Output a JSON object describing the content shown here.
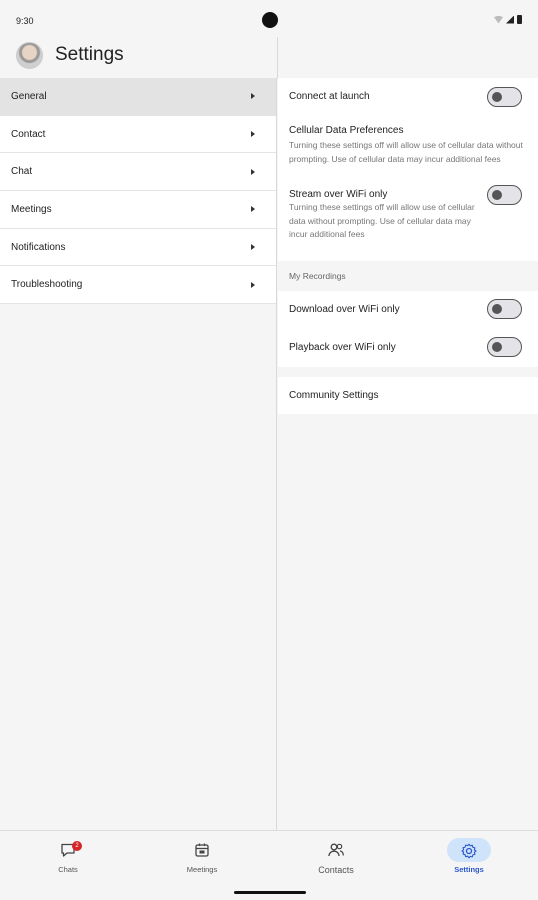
{
  "status": {
    "time": "9:30"
  },
  "header": {
    "title": "Settings"
  },
  "menu": [
    {
      "label": "General",
      "active": true
    },
    {
      "label": "Contact"
    },
    {
      "label": "Chat"
    },
    {
      "label": "Meetings"
    },
    {
      "label": "Notifications"
    },
    {
      "label": "Troubleshooting"
    }
  ],
  "general": {
    "connect_at_launch": {
      "label": "Connect at launch",
      "on": false
    },
    "cellular": {
      "title": "Cellular Data Preferences",
      "description": "Turning these settings off will allow use of cellular data without prompting. Use of cellular data may incur additional fees"
    },
    "stream_wifi": {
      "label": "Stream over WiFi only",
      "description": "Turning these settings off will allow use of cellular data without prompting. Use of cellular data may incur additional fees",
      "on": false
    },
    "recordings_header": "My Recordings",
    "download_wifi": {
      "label": "Download over WiFi only",
      "on": false
    },
    "playback_wifi": {
      "label": "Playback over WiFi only",
      "on": false
    },
    "community": {
      "label": "Community Settings"
    }
  },
  "bottom_nav": [
    {
      "label": "Chats",
      "icon": "chat-icon",
      "badge": "2"
    },
    {
      "label": "Meetings",
      "icon": "calendar-icon"
    },
    {
      "label": "Contacts",
      "icon": "contacts-icon"
    },
    {
      "label": "Settings",
      "icon": "gear-icon",
      "active": true
    }
  ],
  "colors": {
    "accent": "#2b57c9",
    "accent_pill": "#cfe3fb",
    "badge": "#d32626",
    "active_row": "#e3e3e3"
  }
}
